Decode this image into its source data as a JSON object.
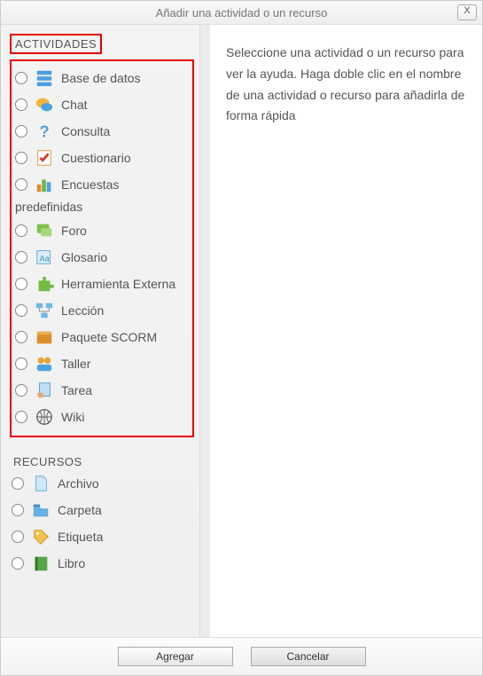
{
  "titlebar": {
    "title": "Añadir una actividad o un recurso"
  },
  "sections": {
    "activities": "ACTIVIDADES",
    "resources": "RECURSOS"
  },
  "help_text": "Seleccione una actividad o un recurso para ver la ayuda. Haga doble clic en el nombre de una actividad o recurso para añadirla de forma rápida",
  "footer": {
    "add": "Agregar",
    "cancel": "Cancelar"
  },
  "activities": {
    "database": {
      "label": "Base de datos",
      "icon": "database-icon"
    },
    "chat": {
      "label": "Chat",
      "icon": "chat-icon"
    },
    "choice": {
      "label": "Consulta",
      "icon": "question-icon"
    },
    "quiz": {
      "label": "Cuestionario",
      "icon": "checkbox-sheet-icon"
    },
    "survey": {
      "label": "Encuestas",
      "sub": "predefinidas",
      "icon": "barchart-icon"
    },
    "forum": {
      "label": "Foro",
      "icon": "speech-green-icon"
    },
    "glossary": {
      "label": "Glosario",
      "icon": "glossary-icon"
    },
    "lti": {
      "label": "Herramienta Externa",
      "icon": "puzzle-icon"
    },
    "lesson": {
      "label": "Lección",
      "icon": "flow-icon"
    },
    "scorm": {
      "label": "Paquete SCORM",
      "icon": "box-icon"
    },
    "workshop": {
      "label": "Taller",
      "icon": "people-icon"
    },
    "assign": {
      "label": "Tarea",
      "icon": "hand-sheet-icon"
    },
    "wiki": {
      "label": "Wiki",
      "icon": "wiki-icon"
    }
  },
  "resources": {
    "file": {
      "label": "Archivo",
      "icon": "file-icon"
    },
    "folder": {
      "label": "Carpeta",
      "icon": "folder-icon"
    },
    "label": {
      "label": "Etiqueta",
      "icon": "tag-icon"
    },
    "book": {
      "label": "Libro",
      "icon": "book-icon"
    }
  }
}
